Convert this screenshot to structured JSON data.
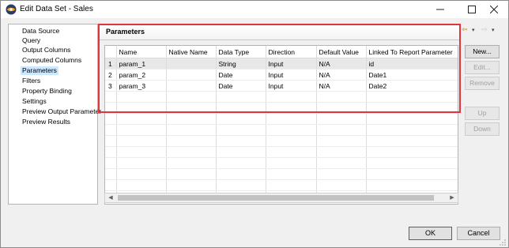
{
  "window": {
    "title": "Edit Data Set - Sales",
    "controls": [
      "minimize-icon",
      "maximize-icon",
      "close-icon"
    ]
  },
  "nav": {
    "items": [
      {
        "label": "Data Source"
      },
      {
        "label": "Query"
      },
      {
        "label": "Output Columns"
      },
      {
        "label": "Computed Columns"
      },
      {
        "label": "Parameters",
        "selected": true
      },
      {
        "label": "Filters"
      },
      {
        "label": "Property Binding"
      },
      {
        "label": "Settings"
      },
      {
        "label": "Preview Output Parameter"
      },
      {
        "label": "Preview Results"
      }
    ]
  },
  "panel": {
    "title": "Parameters",
    "history_icons": [
      "back-arrow-icon",
      "forward-arrow-icon"
    ]
  },
  "table": {
    "columns": [
      "",
      "Name",
      "Native Name",
      "Data Type",
      "Direction",
      "Default Value",
      "Linked To Report Parameter"
    ],
    "rows": [
      {
        "num": "1",
        "name": "param_1",
        "native": "",
        "type": "String",
        "direction": "Input",
        "default": "N/A",
        "linked": "id",
        "selected": true
      },
      {
        "num": "2",
        "name": "param_2",
        "native": "",
        "type": "Date",
        "direction": "Input",
        "default": "N/A",
        "linked": "Date1"
      },
      {
        "num": "3",
        "name": "param_3",
        "native": "",
        "type": "Date",
        "direction": "Input",
        "default": "N/A",
        "linked": "Date2"
      }
    ]
  },
  "buttons": {
    "new": "New...",
    "edit": "Edit...",
    "remove": "Remove",
    "up": "Up",
    "down": "Down"
  },
  "footer": {
    "ok": "OK",
    "cancel": "Cancel"
  },
  "colors": {
    "highlight_box": "#e0353c",
    "selected_nav": "#cce8ff"
  }
}
